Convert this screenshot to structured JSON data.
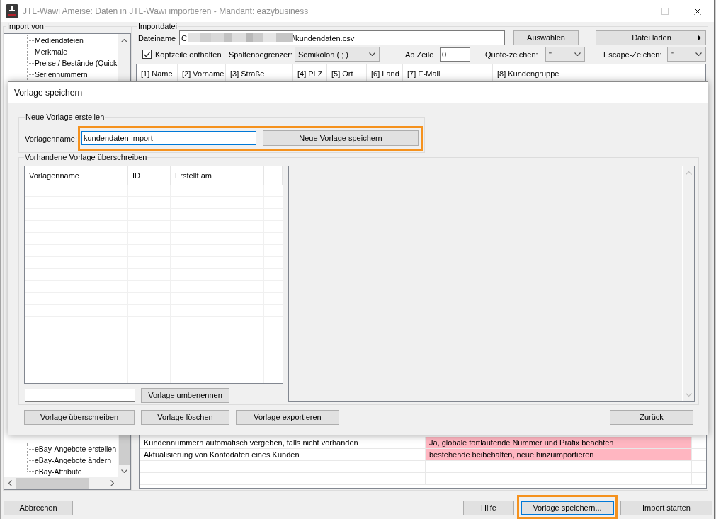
{
  "window": {
    "title": "JTL-Wawi Ameise: Daten in JTL-Wawi importieren - Mandant: eazybusiness",
    "controls": [
      {
        "kind": "minimize",
        "disabled": false
      },
      {
        "kind": "maximize",
        "disabled": true
      },
      {
        "kind": "close",
        "disabled": false
      }
    ]
  },
  "import_from": {
    "label": "Import von",
    "tree_top": [
      {
        "label": "Mediendateien"
      },
      {
        "label": "Merkmale"
      },
      {
        "label": "Preise / Bestände (Quick"
      },
      {
        "label": "Seriennummern"
      }
    ],
    "tree_bottom": [
      {
        "label": "eBay-Angebote erstellen"
      },
      {
        "label": "eBay-Angebote ändern"
      },
      {
        "label": "eBay-Attribute"
      }
    ]
  },
  "import_file": {
    "label": "Importdatei",
    "filename_label": "Dateiname",
    "filename_start": "C",
    "filename_redacted": true,
    "filename_end": "\\kundendaten.csv",
    "choose_button": "Auswählen",
    "load_button": "Datei laden",
    "header_row": {
      "label": "Kopfzeile enthalten",
      "checked": true
    },
    "delimiter": {
      "label": "Spaltenbegrenzer:",
      "value": "Semikolon ( ; )"
    },
    "start_row": {
      "label": "Ab Zeile",
      "value": "0"
    },
    "quote_char": {
      "label": "Quote-zeichen:",
      "value": "\""
    },
    "escape_char": {
      "label": "Escape-Zeichen:",
      "value": "\""
    },
    "columns": [
      "[1] Name",
      "[2] Vorname",
      "[3] Straße",
      "[4] PLZ",
      "[5] Ort",
      "[6] Land",
      "[7] E-Mail",
      "[8] Kundengruppe"
    ]
  },
  "settings": {
    "rows": [
      {
        "name": "Kundennummern automatisch vergeben, falls nicht vorhanden",
        "value": "Ja, globale fortlaufende Nummer und Präfix beachten",
        "highlighted": true
      },
      {
        "name": "Aktualisierung von Kontodaten eines Kunden",
        "value": "bestehende beibehalten, neue hinzuimportieren",
        "highlighted": true
      }
    ]
  },
  "footer": {
    "left_buttons": [
      {
        "label": "Abbrechen",
        "focused": false,
        "highlighted": false
      }
    ],
    "right_buttons": [
      {
        "label": "Hilfe",
        "focused": false,
        "highlighted": false
      },
      {
        "label": "Vorlage speichern...",
        "focused": true,
        "highlighted": true
      },
      {
        "label": "Import starten",
        "focused": false,
        "highlighted": false
      }
    ]
  },
  "dialog": {
    "title": "Vorlage speichern",
    "new_template": {
      "label": "Neue Vorlage erstellen",
      "name_label": "Vorlagenname:",
      "name_value": "kundendaten-import",
      "name_focused": true,
      "save_button": "Neue Vorlage speichern",
      "highlighted": true
    },
    "existing": {
      "label": "Vorhandene Vorlage überschreiben",
      "columns": [
        "Vorlagenname",
        "ID",
        "Erstellt am"
      ],
      "rename_button": "Vorlage umbenennen"
    },
    "buttons": [
      "Vorlage überschreiben",
      "Vorlage löschen",
      "Vorlage exportieren"
    ],
    "back_button": "Zurück"
  }
}
